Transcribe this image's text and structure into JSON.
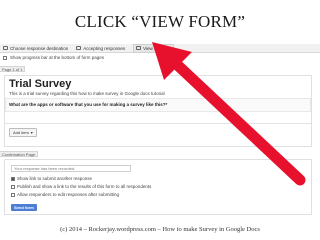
{
  "slide": {
    "title": "CLICK “VIEW FORM”",
    "footer": "(c) 2014 – Rockerjay.wordpress.com – How to make Survey in Google Docs"
  },
  "toolbar": {
    "items": [
      {
        "label": "Choose response destination"
      },
      {
        "label": "Accepting responses"
      },
      {
        "label": "View live form"
      }
    ]
  },
  "progress": {
    "label": "Show progress bar at the bottom of form pages"
  },
  "page_label": "Page 1 of 1",
  "form": {
    "title": "Trial Survey",
    "description": "This is a trial survey regarding this how to make survey in Google docs tutorial",
    "question": "What are the apps or software that you use for making a survey like this?*",
    "add_item_label": "Add item"
  },
  "confirmation": {
    "label": "Confirmation Page",
    "input_value": "Your response has been recorded.",
    "options": [
      {
        "label": "Show link to submit another response",
        "checked": true
      },
      {
        "label": "Publish and show a link to the results of this form to all respondents",
        "checked": false
      },
      {
        "label": "Allow responders to edit responses after submitting",
        "checked": false
      }
    ],
    "send_label": "Send form"
  },
  "colors": {
    "arrow": "#e8112d",
    "send_button": "#4d7ed6"
  }
}
